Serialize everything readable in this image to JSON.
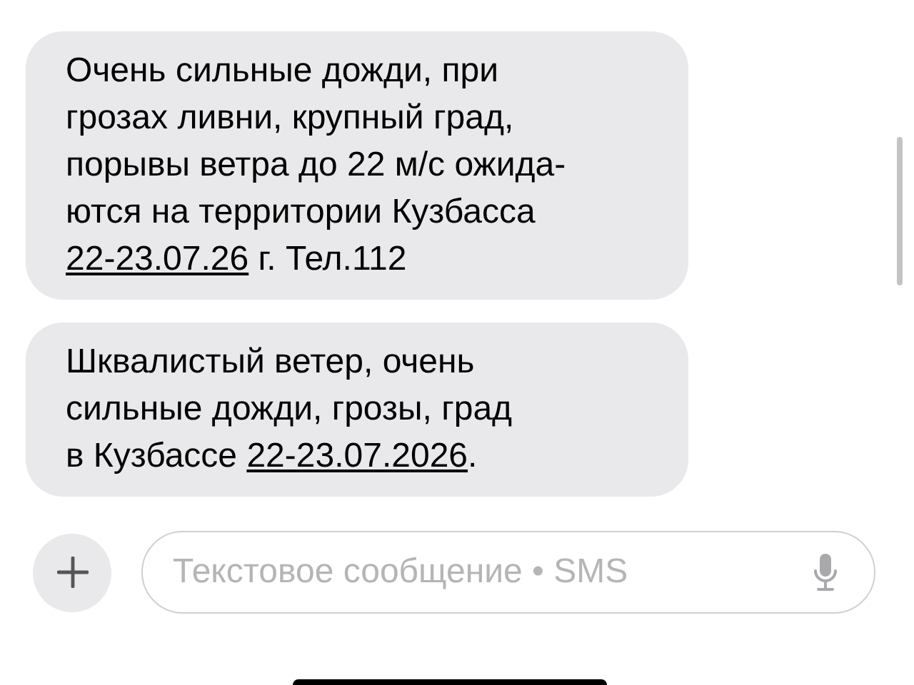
{
  "messages": [
    {
      "parts": [
        {
          "kind": "text",
          "text": "Очень сильные дожди, при\nгрозах ливни, крупный град,\nпорывы ветра до 22 м/с ожида-\nются на территории Кузбасса\n"
        },
        {
          "kind": "link",
          "text": "22-23.07.26"
        },
        {
          "kind": "text",
          "text": " г. Тел.112"
        }
      ]
    },
    {
      "parts": [
        {
          "kind": "text",
          "text": "Шквалистый ветер, очень\nсильные дожди, грозы, град\nв Кузбассе "
        },
        {
          "kind": "link",
          "text": "22-23.07.2026"
        },
        {
          "kind": "text",
          "text": "."
        }
      ]
    }
  ],
  "composer": {
    "placeholder": "Текстовое сообщение • SMS"
  }
}
